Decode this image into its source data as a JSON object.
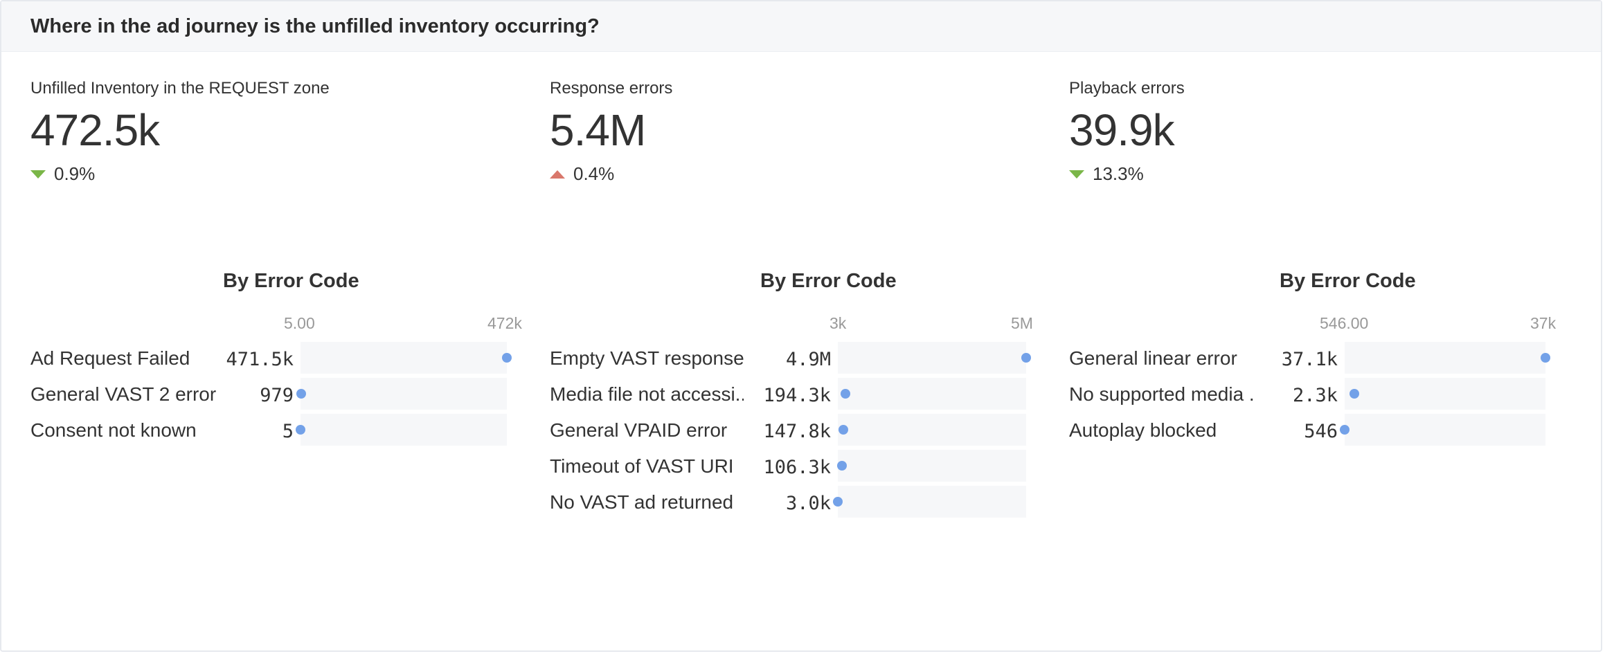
{
  "panel": {
    "title": "Where in the ad journey is the unfilled inventory occurring?"
  },
  "colors": {
    "dot": "#73a1e8",
    "track": "#f6f7f9",
    "delta_down": "#7ab648",
    "delta_up": "#d9776b"
  },
  "kpis": [
    {
      "label": "Unfilled Inventory in the REQUEST zone",
      "value": "472.5k",
      "delta": "0.9%",
      "direction": "down"
    },
    {
      "label": "Response errors",
      "value": "5.4M",
      "delta": "0.4%",
      "direction": "up"
    },
    {
      "label": "Playback errors",
      "value": "39.9k",
      "delta": "13.3%",
      "direction": "down"
    }
  ],
  "charts": [
    {
      "title": "By Error Code",
      "axis_min_label": "5.00",
      "axis_max_label": "472k",
      "axis_min": 5,
      "axis_max": 472000,
      "rows": [
        {
          "label": "Ad Request Failed",
          "value_label": "471.5k",
          "value": 471500
        },
        {
          "label": "General VAST 2 error",
          "value_label": "979",
          "value": 979
        },
        {
          "label": "Consent not known",
          "value_label": "5",
          "value": 5
        }
      ]
    },
    {
      "title": "By Error Code",
      "axis_min_label": "3k",
      "axis_max_label": "5M",
      "axis_min": 3000,
      "axis_max": 4900000,
      "rows": [
        {
          "label": "Empty VAST response",
          "value_label": "4.9M",
          "value": 4900000
        },
        {
          "label": "Media file not accessi...",
          "value_label": "194.3k",
          "value": 194300
        },
        {
          "label": "General VPAID error",
          "value_label": "147.8k",
          "value": 147800
        },
        {
          "label": "Timeout of VAST URI",
          "value_label": "106.3k",
          "value": 106300
        },
        {
          "label": "No VAST ad returned",
          "value_label": "3.0k",
          "value": 3000
        }
      ]
    },
    {
      "title": "By Error Code",
      "axis_min_label": "546.00",
      "axis_max_label": "37k",
      "axis_min": 546,
      "axis_max": 37100,
      "rows": [
        {
          "label": "General linear error",
          "value_label": "37.1k",
          "value": 37100
        },
        {
          "label": "No supported media ...",
          "value_label": "2.3k",
          "value": 2300
        },
        {
          "label": "Autoplay blocked",
          "value_label": "546",
          "value": 546
        }
      ]
    }
  ]
}
